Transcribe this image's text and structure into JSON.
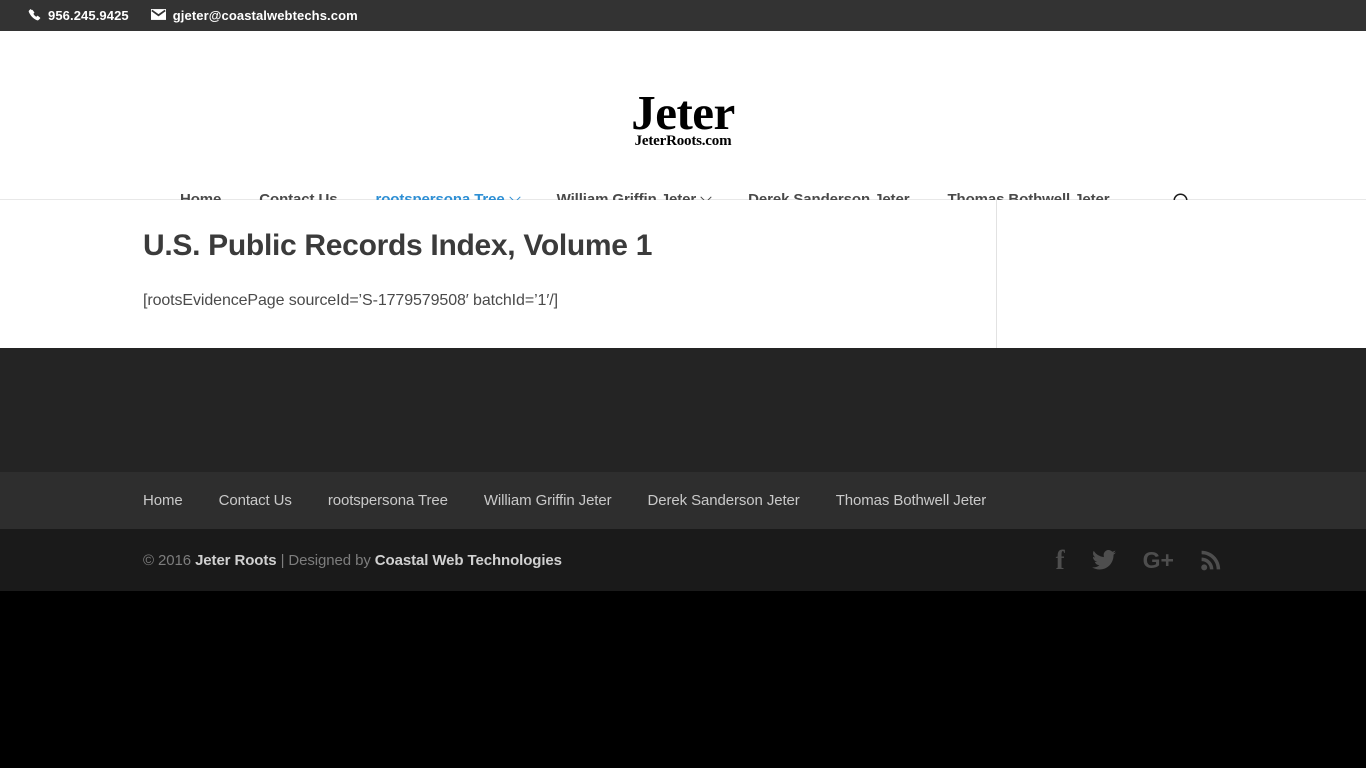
{
  "topbar": {
    "phone_icon": "phone-icon",
    "phone": "956.245.9425",
    "mail_icon": "envelope-icon",
    "email": "gjeter@coastalwebtechs.com"
  },
  "logo": {
    "name": "Jeter",
    "domain": "JeterRoots.com"
  },
  "nav": {
    "items": [
      {
        "label": "Home",
        "active": false,
        "dropdown": false
      },
      {
        "label": "Contact Us",
        "active": false,
        "dropdown": false
      },
      {
        "label": "rootspersona Tree",
        "active": true,
        "dropdown": true
      },
      {
        "label": "William Griffin Jeter",
        "active": false,
        "dropdown": true
      },
      {
        "label": "Derek Sanderson Jeter",
        "active": false,
        "dropdown": false
      },
      {
        "label": "Thomas Bothwell Jeter",
        "active": false,
        "dropdown": false
      }
    ],
    "search_icon": "search-icon"
  },
  "main": {
    "title": "U.S. Public Records Index, Volume 1",
    "body": "[rootsEvidencePage sourceId=’S-1779579508′ batchId=’1′/]"
  },
  "footer_nav": {
    "items": [
      {
        "label": "Home"
      },
      {
        "label": "Contact Us"
      },
      {
        "label": "rootspersona Tree"
      },
      {
        "label": "William Griffin Jeter"
      },
      {
        "label": "Derek Sanderson Jeter"
      },
      {
        "label": "Thomas Bothwell Jeter"
      }
    ]
  },
  "copyright": {
    "prefix": "© 2016 ",
    "site": "Jeter Roots",
    "middle": " | Designed by ",
    "designer": "Coastal Web Technologies"
  },
  "social": [
    {
      "name": "facebook-icon",
      "glyph": "f"
    },
    {
      "name": "twitter-icon",
      "glyph": ""
    },
    {
      "name": "google-plus-icon",
      "glyph": "G+"
    },
    {
      "name": "rss-icon",
      "glyph": ""
    }
  ],
  "colors": {
    "accent": "#2e8fd4",
    "topbar_bg": "#333333",
    "widget_bg": "#242424",
    "footer_nav_bg": "#2e2e2e",
    "copy_bg": "#1a1a1a"
  }
}
